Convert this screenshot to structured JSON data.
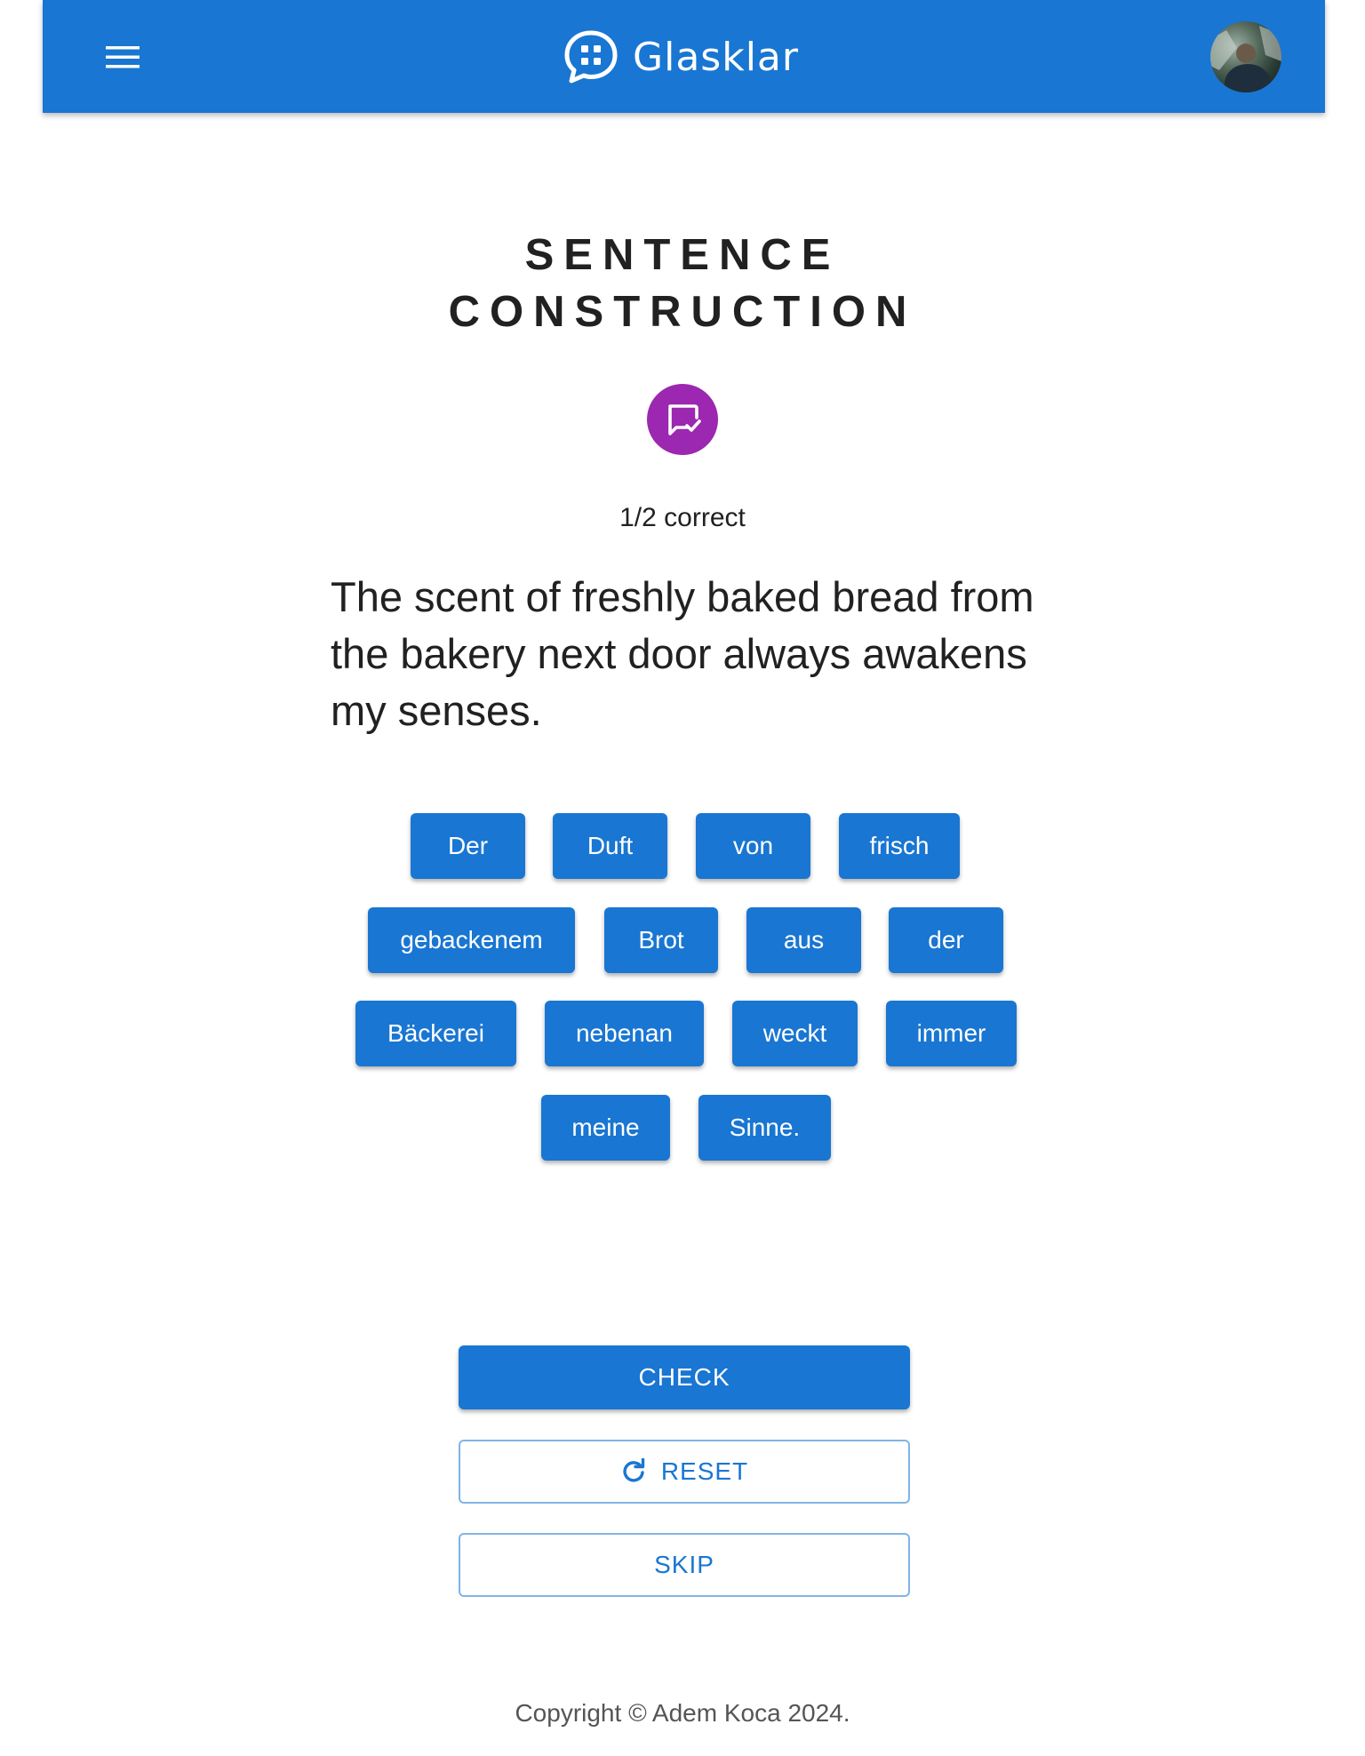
{
  "header": {
    "brand": "Glasklar",
    "menu_icon": "menu-icon",
    "logo_icon": "chat-logo-icon"
  },
  "exercise": {
    "title_line1": "SENTENCE",
    "title_line2": "CONSTRUCTION",
    "badge_icon": "chat-check-icon",
    "badge_color": "#9c27b0",
    "score": "1/2 correct",
    "sentence": "The scent of freshly baked bread from the bakery next door always awakens my senses.",
    "words": [
      "Der",
      "Duft",
      "von",
      "frisch",
      "gebackenem",
      "Brot",
      "aus",
      "der",
      "Bäckerei",
      "nebenan",
      "weckt",
      "immer",
      "meine",
      "Sinne."
    ]
  },
  "actions": {
    "check": "CHECK",
    "reset": "RESET",
    "reset_icon": "refresh-icon",
    "skip": "SKIP"
  },
  "footer": {
    "copyright": "Copyright © Adem Koca 2024."
  },
  "colors": {
    "primary": "#1976d2",
    "text": "#212121",
    "muted": "#555555"
  }
}
